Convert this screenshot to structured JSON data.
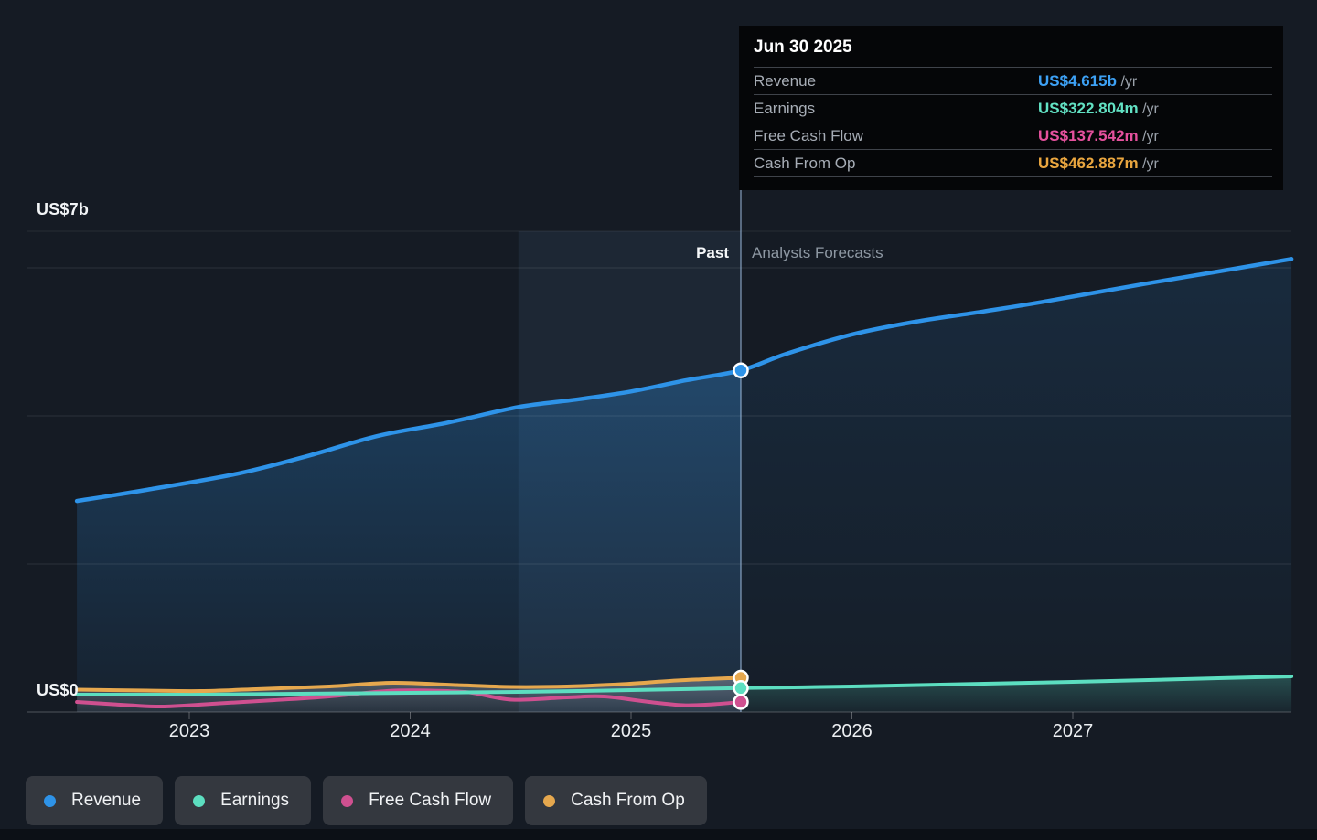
{
  "axis": {
    "y_top_label": "US$7b",
    "y_zero_label": "US$0"
  },
  "sections": {
    "past_label": "Past",
    "forecast_label": "Analysts Forecasts"
  },
  "tooltip": {
    "date": "Jun 30 2025",
    "rows": [
      {
        "label": "Revenue",
        "value": "US$4.615b",
        "suffix": " /yr",
        "color": "#3da1f5"
      },
      {
        "label": "Earnings",
        "value": "US$322.804m",
        "suffix": " /yr",
        "color": "#62e2c4"
      },
      {
        "label": "Free Cash Flow",
        "value": "US$137.542m",
        "suffix": " /yr",
        "color": "#e5519d"
      },
      {
        "label": "Cash From Op",
        "value": "US$462.887m",
        "suffix": " /yr",
        "color": "#eaa63f"
      }
    ]
  },
  "legend": {
    "items": [
      {
        "label": "Revenue",
        "color": "#2e93e8"
      },
      {
        "label": "Earnings",
        "color": "#5cdec0"
      },
      {
        "label": "Free Cash Flow",
        "color": "#cf5090"
      },
      {
        "label": "Cash From Op",
        "color": "#e6a84e"
      }
    ]
  },
  "chart_data": {
    "type": "line",
    "y_unit": "US$ billions",
    "y_axis_labels": [
      "US$0",
      "US$7b"
    ],
    "x_ticks": [
      "2023",
      "2024",
      "2025",
      "2026",
      "2027"
    ],
    "x_tick_years": [
      2023,
      2024,
      2025,
      2026,
      2027
    ],
    "x_range": [
      2022.49,
      2027.99
    ],
    "ylim": [
      0,
      6.5
    ],
    "y_gridlines": [
      0,
      2,
      4,
      6
    ],
    "divider_x": 2025.497,
    "divider_date": "Jun 30 2025",
    "highlight_band_x": [
      2024.49,
      2025.497
    ],
    "legend_position": "bottom",
    "series": [
      {
        "name": "Revenue",
        "color": "#2e93e8",
        "has_forecast": true,
        "points": [
          [
            2022.491,
            2.85
          ],
          [
            2022.805,
            3.0
          ],
          [
            2023.219,
            3.22
          ],
          [
            2023.55,
            3.47
          ],
          [
            2023.853,
            3.73
          ],
          [
            2024.172,
            3.91
          ],
          [
            2024.49,
            4.12
          ],
          [
            2024.752,
            4.22
          ],
          [
            2025.0,
            4.33
          ],
          [
            2025.248,
            4.48
          ],
          [
            2025.497,
            4.615
          ],
          [
            2025.704,
            4.84
          ],
          [
            2026.0,
            5.1
          ],
          [
            2026.284,
            5.27
          ],
          [
            2026.594,
            5.41
          ],
          [
            2026.863,
            5.54
          ],
          [
            2027.319,
            5.78
          ],
          [
            2027.638,
            5.94
          ],
          [
            2027.99,
            6.12
          ]
        ]
      },
      {
        "name": "Earnings",
        "color": "#5cdec0",
        "has_forecast": true,
        "points": [
          [
            2022.491,
            0.235
          ],
          [
            2023.0,
            0.235
          ],
          [
            2023.5,
            0.247
          ],
          [
            2024.0,
            0.259
          ],
          [
            2024.49,
            0.272
          ],
          [
            2025.0,
            0.296
          ],
          [
            2025.497,
            0.323
          ],
          [
            2026.0,
            0.346
          ],
          [
            2026.5,
            0.377
          ],
          [
            2027.0,
            0.407
          ],
          [
            2027.5,
            0.444
          ],
          [
            2027.99,
            0.481
          ]
        ]
      },
      {
        "name": "Free Cash Flow",
        "color": "#cf5090",
        "has_forecast": false,
        "points": [
          [
            2022.491,
            0.136
          ],
          [
            2022.723,
            0.093
          ],
          [
            2022.888,
            0.074
          ],
          [
            2023.137,
            0.117
          ],
          [
            2023.385,
            0.16
          ],
          [
            2023.634,
            0.21
          ],
          [
            2023.894,
            0.284
          ],
          [
            2024.089,
            0.29
          ],
          [
            2024.267,
            0.265
          ],
          [
            2024.461,
            0.167
          ],
          [
            2024.71,
            0.198
          ],
          [
            2024.876,
            0.21
          ],
          [
            2025.083,
            0.136
          ],
          [
            2025.236,
            0.093
          ],
          [
            2025.373,
            0.105
          ],
          [
            2025.497,
            0.1375
          ]
        ]
      },
      {
        "name": "Cash From Op",
        "color": "#e6a84e",
        "has_forecast": false,
        "points": [
          [
            2022.491,
            0.302
          ],
          [
            2022.805,
            0.29
          ],
          [
            2023.054,
            0.284
          ],
          [
            2023.302,
            0.309
          ],
          [
            2023.634,
            0.346
          ],
          [
            2023.923,
            0.395
          ],
          [
            2024.213,
            0.364
          ],
          [
            2024.461,
            0.34
          ],
          [
            2024.71,
            0.346
          ],
          [
            2024.959,
            0.377
          ],
          [
            2025.207,
            0.426
          ],
          [
            2025.497,
            0.4629
          ]
        ]
      }
    ],
    "marker_date": "Jun 30 2025",
    "marker_values": {
      "Revenue": 4.615,
      "Earnings": 0.323,
      "Free Cash Flow": 0.1375,
      "Cash From Op": 0.4629
    }
  }
}
